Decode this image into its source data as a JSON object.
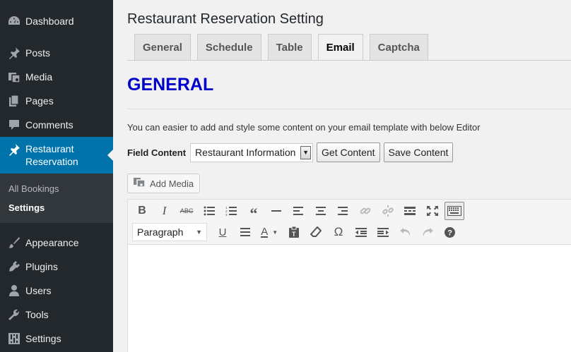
{
  "sidebar": {
    "top_items": [
      {
        "label": "Dashboard",
        "icon": "dashboard-icon"
      }
    ],
    "items": [
      {
        "label": "Posts",
        "icon": "pin-icon"
      },
      {
        "label": "Media",
        "icon": "media-icon"
      },
      {
        "label": "Pages",
        "icon": "pages-icon"
      },
      {
        "label": "Comments",
        "icon": "comment-icon"
      }
    ],
    "active": {
      "label_line1": "Restaurant",
      "label_line2": "Reservation",
      "icon": "pin-icon"
    },
    "submenu": [
      {
        "label": "All Bookings"
      },
      {
        "label": "Settings"
      }
    ],
    "bottom_items": [
      {
        "label": "Appearance",
        "icon": "brush-icon"
      },
      {
        "label": "Plugins",
        "icon": "plug-icon"
      },
      {
        "label": "Users",
        "icon": "user-icon"
      },
      {
        "label": "Tools",
        "icon": "wrench-icon"
      },
      {
        "label": "Settings",
        "icon": "settings-icon"
      }
    ]
  },
  "main": {
    "title": "Restaurant Reservation Setting",
    "tabs": [
      {
        "label": "General"
      },
      {
        "label": "Schedule"
      },
      {
        "label": "Table"
      },
      {
        "label": "Email"
      },
      {
        "label": "Captcha"
      }
    ],
    "active_tab": "Email",
    "section_heading": "GENERAL",
    "description": "You can easier to add and style some content on your email template with below Editor",
    "field_label": "Field Content",
    "field_select_value": "Restaurant Information",
    "get_content_label": "Get Content",
    "save_content_label": "Save Content",
    "add_media_label": "Add Media",
    "format_select_value": "Paragraph"
  },
  "colors": {
    "sidebar_bg": "#23282d",
    "active_bg": "#0073aa",
    "heading": "#0000cc"
  }
}
